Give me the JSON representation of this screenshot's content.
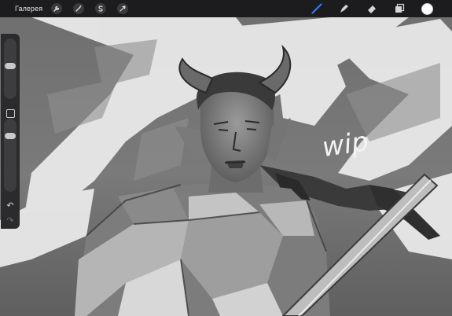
{
  "topbar": {
    "gallery_label": "Галерея",
    "left_tools": [
      "wrench-icon",
      "magic-wand-icon",
      "selection-s-icon",
      "transform-arrow-icon"
    ],
    "right_tools": [
      "brush-icon",
      "smudge-icon",
      "eraser-icon",
      "layers-icon"
    ],
    "active_tool": "brush-icon",
    "accent_color": "#2f7bf5",
    "current_color": "#ffffff"
  },
  "sidebar": {
    "brush_size_level": 0.55,
    "opacity_level": 0.8,
    "modify_icon": "square-icon",
    "undo_icon": "undo-icon",
    "redo_icon": "redo-icon"
  },
  "canvas": {
    "sketch_text": "wip"
  }
}
